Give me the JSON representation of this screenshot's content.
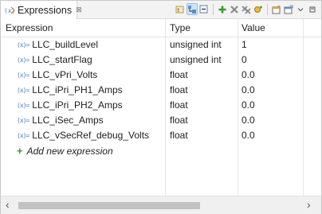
{
  "view": {
    "title": "Expressions",
    "close_glyph": "⊠",
    "tab_icon": "expressions-view-icon"
  },
  "toolbar": {
    "icons": [
      "show-type-names-icon",
      "show-logical-structure-icon",
      "collapse-all-icon",
      "add-expression-icon",
      "remove-expression-icon",
      "remove-all-icon",
      "add-watch-icon",
      "new-view-icon",
      "pin-view-icon",
      "view-menu-icon",
      "minimize-icon"
    ]
  },
  "table": {
    "columns": {
      "expression": "Expression",
      "type": "Type",
      "value": "Value"
    },
    "rows": [
      {
        "expression": "LLC_buildLevel",
        "type": "unsigned int",
        "value": "1"
      },
      {
        "expression": "LLC_startFlag",
        "type": "unsigned int",
        "value": "0"
      },
      {
        "expression": "LLC_vPri_Volts",
        "type": "float",
        "value": "0.0"
      },
      {
        "expression": "LLC_iPri_PH1_Amps",
        "type": "float",
        "value": "0.0"
      },
      {
        "expression": "LLC_iPri_PH2_Amps",
        "type": "float",
        "value": "0.0"
      },
      {
        "expression": "LLC_iSec_Amps",
        "type": "float",
        "value": "0.0"
      },
      {
        "expression": "LLC_vSecRef_debug_Volts",
        "type": "float",
        "value": "0.0"
      }
    ],
    "add_label": "Add new expression",
    "var_icon": "(x)="
  },
  "scrollbar": {
    "left_arrow": "‹",
    "right_arrow": "›"
  },
  "colors": {
    "add_plus": "#3a9a2f",
    "var_icon": "#4a7fbf",
    "active_toggle": "#cfe3f7"
  }
}
